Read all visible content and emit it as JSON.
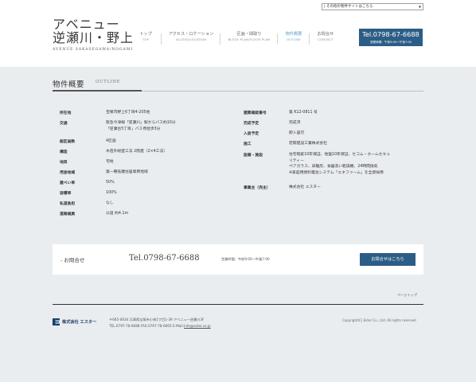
{
  "header": {
    "logo_main": "アベニュー\n逆瀬川・野上",
    "logo_line1": "アベニュー",
    "logo_line2": "逆瀬川・野上",
    "logo_sub": "AVENUE SAKASEGAWA/NOGAMI",
    "site_select": "| その他の物件サイトはこちら",
    "nav": [
      {
        "jp": "トップ",
        "en": "TOP"
      },
      {
        "jp": "アクセス・ロケーション",
        "en": "ACCESS/LOCATION"
      },
      {
        "jp": "区画・間取り",
        "en": "BLOCK PLAN/FLOOR PLAN"
      },
      {
        "jp": "物件概要",
        "en": "OUTLINE"
      },
      {
        "jp": "お問合せ",
        "en": "CONTACT"
      }
    ],
    "tel": "Tel.0798-67-6688",
    "tel_hours": "営業時間：午前9:00〜午後7:00"
  },
  "page": {
    "title": "物件概要",
    "title_en": "OUTLINE"
  },
  "spec_left": [
    {
      "label": "所在地",
      "value": [
        "宝塚市野上6丁目4-205他"
      ]
    },
    {
      "label": "交通",
      "value": [
        "阪急今津線「逆瀬川」駅からバス約10分",
        "「逆瀬台5丁目」バス停徒歩3分"
      ]
    },
    {
      "label": "総区画数",
      "value": [
        "4区画"
      ]
    },
    {
      "label": "構造",
      "value": [
        "木造外総壁工法 2階建（2×4工法）"
      ]
    },
    {
      "label": "地目",
      "value": [
        "宅地"
      ]
    },
    {
      "label": "用途地域",
      "value": [
        "第一種低層住居専用地域"
      ]
    },
    {
      "label": "建ぺい率",
      "value": [
        "50%"
      ]
    },
    {
      "label": "容積率",
      "value": [
        "100%"
      ]
    },
    {
      "label": "私道負担",
      "value": [
        "なし"
      ]
    },
    {
      "label": "道路幅員",
      "value": [
        "公道 約4.1m"
      ]
    }
  ],
  "spec_right": [
    {
      "label": "建築確認番号",
      "value": [
        "第 K12-0811 号"
      ]
    },
    {
      "label": "完成予定",
      "value": [
        "完成済"
      ]
    },
    {
      "label": "入居予定",
      "value": [
        "即入居可"
      ]
    },
    {
      "label": "施工",
      "value": [
        "宏関建設工業株式会社"
      ]
    },
    {
      "label": "設備・施設",
      "value": [
        "住宅瑕疵10年保証、地盤10年保証、セコム・ホームセキュ",
        "リティー",
        "ペアガラス、床暖房、食器洗い乾燥機、24時間換気",
        "※家庭用燃料電池システム「エネファーム」を全邸採用"
      ]
    },
    {
      "label": "事業主（売主）",
      "value": [
        "株式会社 エスター"
      ]
    }
  ],
  "contact": {
    "label": "- お問合せ",
    "tel": "Tel.0798-67-6688",
    "hours": "営業時間：午前9:00〜午後7:00",
    "button": "お問合せはこちら"
  },
  "pagetop": "ページトップ",
  "footer": {
    "company": "株式会社 エスター",
    "address": "〒665-0034 兵庫県宝塚市小林1丁目1-39 アベニュー逆瀬川3F",
    "telfax": "TEL.0797-78-6688 FAX.0797-78-6665 E-Mail:",
    "email": "info@ester.co.jp",
    "copyright": "Copyright(C) Ester Co., Ltd.  All rights reserved"
  },
  "colors": {
    "accent_blue": "#2c5d86",
    "active_nav": "#5a9ec4",
    "page_bg": "#eaedf0"
  }
}
